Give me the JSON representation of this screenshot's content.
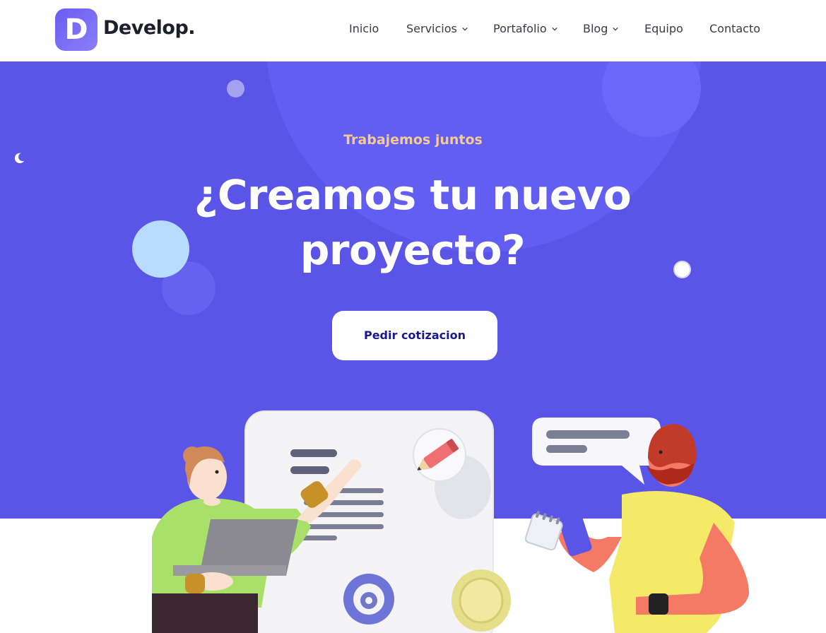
{
  "brand": {
    "mark": "D",
    "name": "Develop."
  },
  "nav": {
    "items": [
      {
        "label": "Inicio",
        "has_dropdown": false
      },
      {
        "label": "Servicios",
        "has_dropdown": true
      },
      {
        "label": "Portafolio",
        "has_dropdown": true
      },
      {
        "label": "Blog",
        "has_dropdown": true
      },
      {
        "label": "Equipo",
        "has_dropdown": false
      },
      {
        "label": "Contacto",
        "has_dropdown": false
      }
    ]
  },
  "hero": {
    "eyebrow": "Trabajemos juntos",
    "title_line1": "¿Creamos tu nuevo",
    "title_line2": "proyecto?",
    "cta_label": "Pedir cotizacion"
  },
  "colors": {
    "hero_bg": "#5a55e6",
    "accent": "#f6cb91",
    "cta_text": "#1b1890"
  },
  "icons": [
    "moon-icon",
    "chevron-down-icon"
  ]
}
